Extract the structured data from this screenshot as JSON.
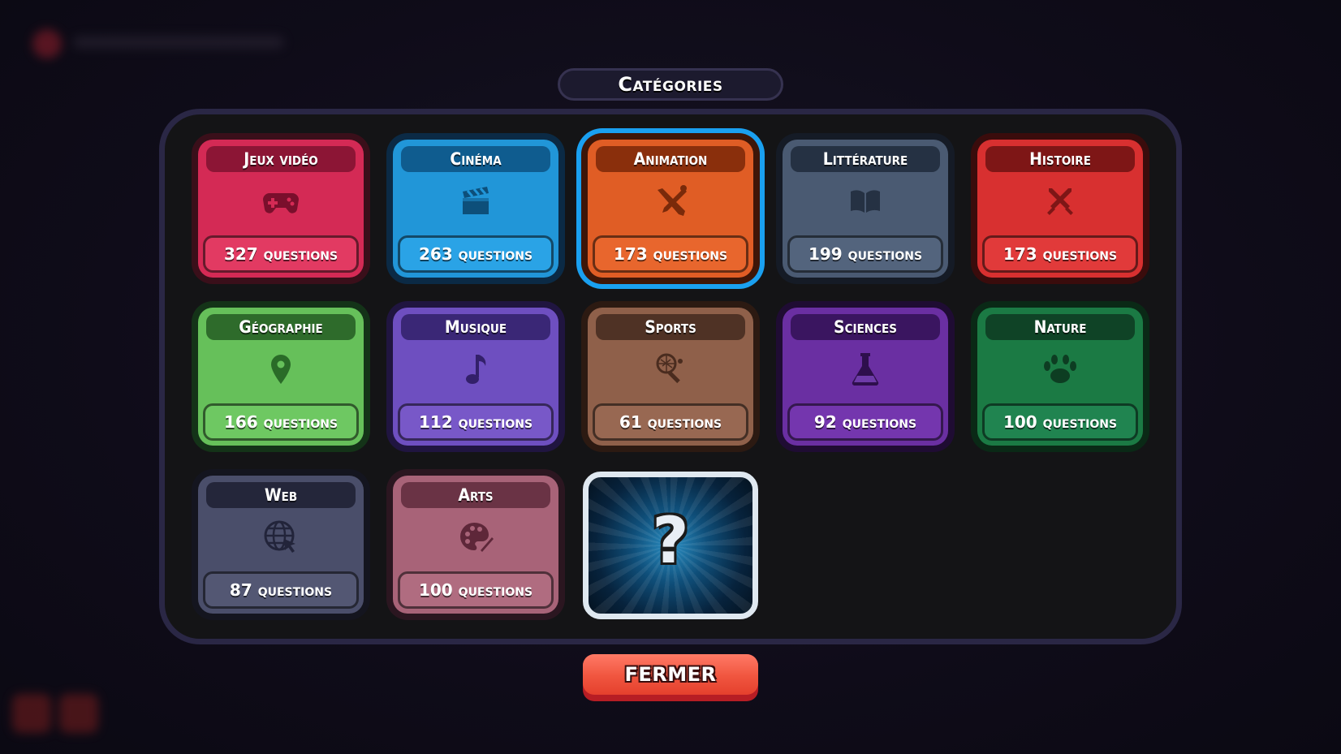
{
  "title": "Catégories",
  "close_label": "FERMER",
  "mystery_symbol": "?",
  "categories": [
    {
      "name": "Jeux vidéo",
      "count": "327 questions",
      "icon": "gamepad-icon",
      "selected": false
    },
    {
      "name": "Cinéma",
      "count": "263 questions",
      "icon": "clapperboard-icon",
      "selected": false
    },
    {
      "name": "Animation",
      "count": "173 questions",
      "icon": "pencil-brush-icon",
      "selected": true
    },
    {
      "name": "Littérature",
      "count": "199 questions",
      "icon": "book-icon",
      "selected": false
    },
    {
      "name": "Histoire",
      "count": "173 questions",
      "icon": "crossed-swords-icon",
      "selected": false
    },
    {
      "name": "Géographie",
      "count": "166 questions",
      "icon": "map-pin-icon",
      "selected": false
    },
    {
      "name": "Musique",
      "count": "112 questions",
      "icon": "music-note-icon",
      "selected": false
    },
    {
      "name": "Sports",
      "count": "61 questions",
      "icon": "racket-ball-icon",
      "selected": false
    },
    {
      "name": "Sciences",
      "count": "92 questions",
      "icon": "flask-icon",
      "selected": false
    },
    {
      "name": "Nature",
      "count": "100 questions",
      "icon": "paw-icon",
      "selected": false
    },
    {
      "name": "Web",
      "count": "87 questions",
      "icon": "globe-cursor-icon",
      "selected": false
    },
    {
      "name": "Arts",
      "count": "100 questions",
      "icon": "palette-icon",
      "selected": false
    }
  ],
  "colors": {
    "jeux": "#d42a55",
    "cinema": "#2196d8",
    "animation": "#e05d25",
    "litterature": "#4a5a72",
    "histoire": "#d83030",
    "geo": "#66c05a",
    "musique": "#6e4fc0",
    "sports": "#8f604a",
    "sciences": "#6a2fa2",
    "nature": "#1b7a44",
    "web": "#4a4e6a",
    "arts": "#a86378"
  }
}
